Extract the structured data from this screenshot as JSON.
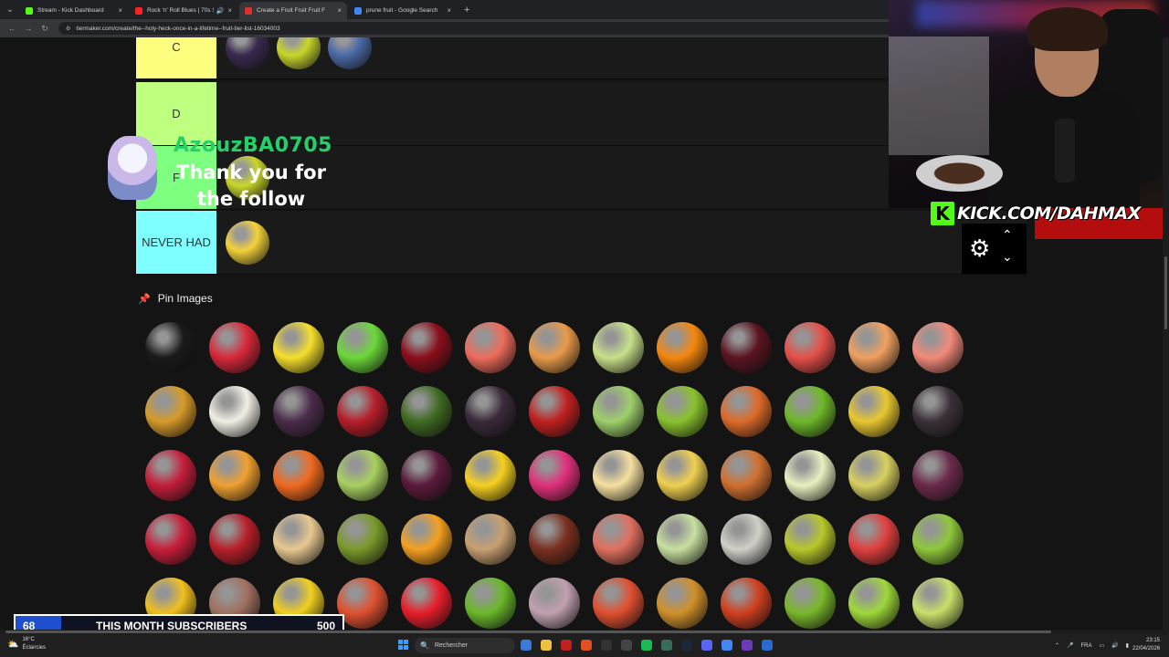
{
  "browser": {
    "tabs": [
      {
        "title": "Stream - Kick Dashboard",
        "favicon_color": "#53fc18",
        "active": false,
        "speaker": false
      },
      {
        "title": "Rock 'n' Roll Blues | 70s Su",
        "favicon_color": "#ff2020",
        "active": false,
        "speaker": true
      },
      {
        "title": "Create a Fruit Fruit Fruit F",
        "favicon_color": "#e03030",
        "active": true,
        "speaker": false
      },
      {
        "title": "prune fruit - Google Search",
        "favicon_color": "#4285f4",
        "active": false,
        "speaker": false
      }
    ],
    "new_tab_symbol": "+",
    "close_symbol": "×",
    "url": "tiermaker.com/create/the--holy-heck-once-in-a-lifetime--fruit-tier-list-16034003"
  },
  "tiers": [
    {
      "label": "C",
      "color": "#ffff7f",
      "items": [
        "#3a2a50",
        "#c9d62a",
        "#4b6aa8"
      ]
    },
    {
      "label": "D",
      "color": "#bfff7f",
      "items": []
    },
    {
      "label": "F",
      "color": "#7fff7f",
      "items": [
        "#c9d62a"
      ]
    },
    {
      "label": "NEVER HAD",
      "color": "#7fffff",
      "items": [
        "#f4d23a"
      ]
    }
  ],
  "pin_section": {
    "title": "Pin Images"
  },
  "pin_images": [
    [
      "#1a1a1a",
      "#d8283a",
      "#f5df2c",
      "#6cd83a",
      "#8a0f1c",
      "#ee6c5c",
      "#e89a4a",
      "#c8e08a",
      "#f5870f",
      "#5a1420",
      "#e6504a",
      "#f0a060",
      "#f28a7a"
    ],
    [
      "#d69a2a",
      "#f2efe6",
      "#4a2c4a",
      "#b61e2a",
      "#3f6a22",
      "#3a2a3a",
      "#c02020",
      "#9ed06a",
      "#8ac22e",
      "#dd6a2a",
      "#6eb82a",
      "#e8c830",
      "#3a3038"
    ],
    [
      "#c41e3a",
      "#f0a030",
      "#f06a20",
      "#a8d060",
      "#5a1a3a",
      "#f5d020",
      "#e0307a",
      "#f5e0a0",
      "#f0d050",
      "#d07030",
      "#e8f0c0",
      "#d8d060",
      "#6a2a4a"
    ],
    [
      "#c81e3a",
      "#b8202a",
      "#e8c890",
      "#7a9a2a",
      "#f5a020",
      "#c8a070",
      "#7a3020",
      "#e07060",
      "#c8e0a0",
      "#d0d0c8",
      "#b8c82a",
      "#e04040",
      "#8ec83a"
    ],
    [
      "#f0c020",
      "#a07060",
      "#f0d020",
      "#e05030",
      "#e81e2a",
      "#6ab82a",
      "#c0a0b0",
      "#e05030",
      "#d0902a",
      "#d04020",
      "#7ab82a",
      "#9ed83a",
      "#c8e06a"
    ]
  ],
  "follow_alert": {
    "username": "AzouzBA0705",
    "message_line1": "Thank you for",
    "message_line2": "the follow"
  },
  "overlay": {
    "kick_letter": "K",
    "kick_url": "KICK.COM/DAHMAX",
    "settings_icon": "gear-icon"
  },
  "sub_goal": {
    "current": "68",
    "label": "THIS MONTH SUBSCRIBERS",
    "target": "500",
    "progress": 0.136
  },
  "taskbar": {
    "weather_temp": "16°C",
    "weather_desc": "Éclaircies",
    "search_label": "Rechercher",
    "language": "FRA",
    "time": "23:15",
    "date": "22/04/2026"
  }
}
